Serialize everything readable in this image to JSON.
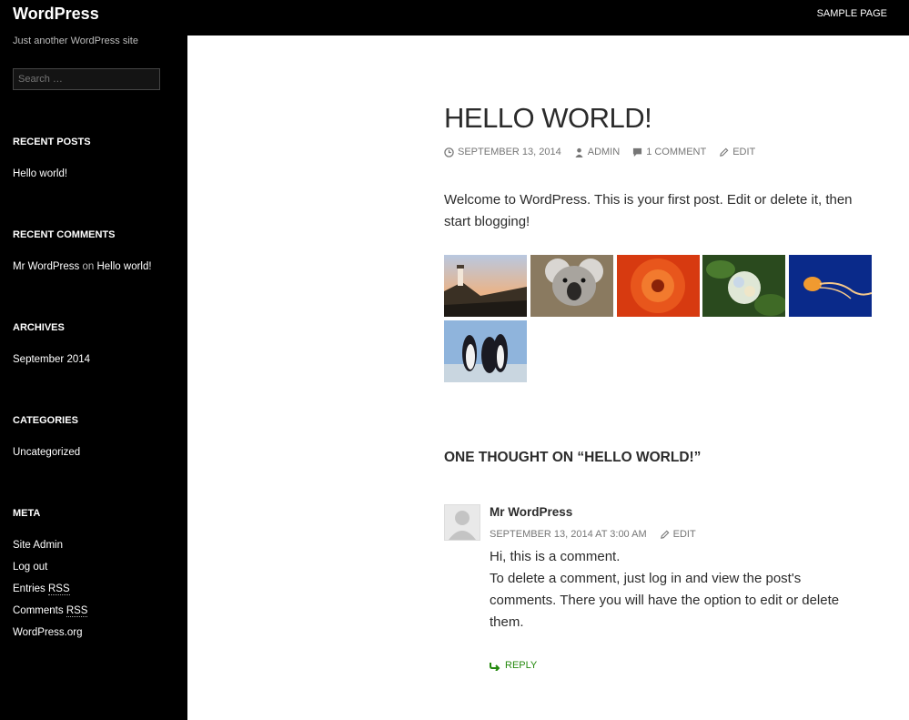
{
  "site": {
    "title": "WordPress",
    "tagline": "Just another WordPress site"
  },
  "nav": {
    "sample_page": "SAMPLE PAGE"
  },
  "search": {
    "placeholder": "Search …"
  },
  "widgets": {
    "recent_posts": {
      "title": "RECENT POSTS",
      "items": [
        "Hello world!"
      ]
    },
    "recent_comments": {
      "title": "RECENT COMMENTS",
      "author": "Mr WordPress",
      "on": "on",
      "post": "Hello world!"
    },
    "archives": {
      "title": "ARCHIVES",
      "items": [
        "September 2014"
      ]
    },
    "categories": {
      "title": "CATEGORIES",
      "items": [
        "Uncategorized"
      ]
    },
    "meta": {
      "title": "META",
      "site_admin": "Site Admin",
      "log_out": "Log out",
      "entries": "Entries",
      "comments": "Comments",
      "rss": "RSS",
      "wordpress_org": "WordPress.org"
    }
  },
  "post": {
    "title": "HELLO WORLD!",
    "date": "SEPTEMBER 13, 2014",
    "author": "ADMIN",
    "comments": "1 COMMENT",
    "edit": "EDIT",
    "excerpt": "Welcome to WordPress. This is your first post. Edit or delete it, then start blogging!",
    "gallery": [
      {
        "name": "lighthouse-image"
      },
      {
        "name": "koala-image"
      },
      {
        "name": "chrysanthemum-image"
      },
      {
        "name": "hydrangeas-image"
      },
      {
        "name": "jellyfish-image"
      },
      {
        "name": "penguins-image"
      }
    ]
  },
  "comments_section": {
    "title": "ONE THOUGHT ON “HELLO WORLD!”",
    "comment": {
      "author": "Mr WordPress",
      "date": "SEPTEMBER 13, 2014 AT 3:00 AM",
      "edit": "EDIT",
      "line1": "Hi, this is a comment.",
      "line2": "To delete a comment, just log in and view the post's comments. There you will have the option to edit or delete them.",
      "reply": "REPLY"
    }
  },
  "colors": {
    "accent_green": "#24890d",
    "sidebar_bg": "#000000"
  }
}
